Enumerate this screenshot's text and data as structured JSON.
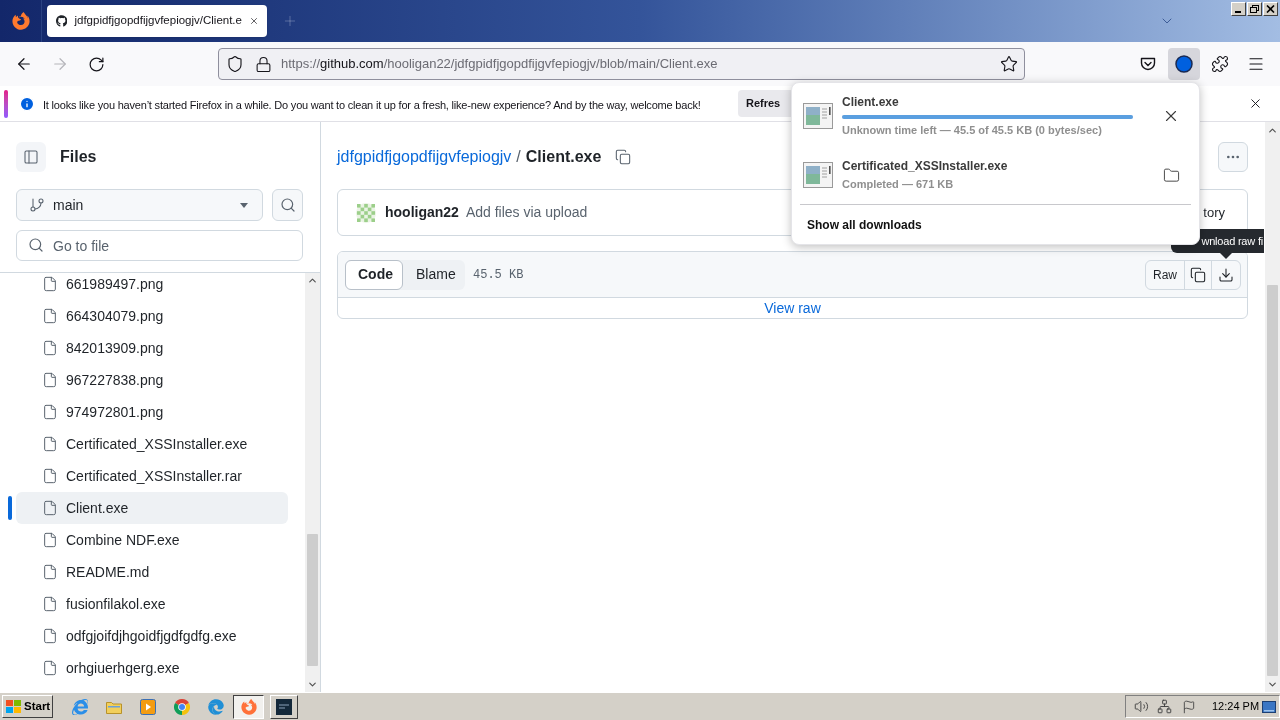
{
  "browser": {
    "tabs": [
      {
        "title": "jdfgpidfjgopdfijgvfepiogjv/Client.e",
        "selected": true
      }
    ],
    "nav": {
      "back_disabled": false,
      "forward_disabled": true
    },
    "address": {
      "scheme": "https://",
      "host": "github.com",
      "path": "/hooligan22/jdfgpidfjgopdfijgvfepiogjv/blob/main/Client.exe"
    },
    "downloads_button": {
      "open": true
    }
  },
  "notification": {
    "message": "It looks like you haven’t started Firefox in a while. Do you want to clean it up for a fresh, like-new experience? And by the way, welcome back!",
    "button": "Refres"
  },
  "downloads_panel": {
    "items": [
      {
        "kind": "in_progress",
        "name": "Client.exe",
        "level": 1,
        "status": "Unknown time left — 45.5 of 45.5 KB (0 bytes/sec)"
      },
      {
        "kind": "completed",
        "name": "Certificated_XSSInstaller.exe",
        "status": "Completed — 671 KB"
      }
    ],
    "footer": "Show all downloads"
  },
  "sidebar": {
    "title": "Files",
    "branch": "main",
    "search": {
      "placeholder": "Go to file"
    },
    "files": [
      {
        "name": "661989497.png",
        "selected": false
      },
      {
        "name": "664304079.png",
        "selected": false
      },
      {
        "name": "842013909.png",
        "selected": false
      },
      {
        "name": "967227838.png",
        "selected": false
      },
      {
        "name": "974972801.png",
        "selected": false
      },
      {
        "name": "Certificated_XSSInstaller.exe",
        "selected": false
      },
      {
        "name": "Certificated_XSSInstaller.rar",
        "selected": false
      },
      {
        "name": "Client.exe",
        "selected": true
      },
      {
        "name": "Combine NDF.exe",
        "selected": false
      },
      {
        "name": "README.md",
        "selected": false
      },
      {
        "name": "fusionfilakol.exe",
        "selected": false
      },
      {
        "name": "odfgjoifdjhgoidfjgdfgdfg.exe",
        "selected": false
      },
      {
        "name": "orhgiuerhgerg.exe",
        "selected": false
      }
    ]
  },
  "file_header": {
    "repo": "jdfgpidfjgopdfijgvfepiogjv",
    "separator": "/",
    "file": "Client.exe"
  },
  "commit": {
    "author": "hooligan22",
    "message": "Add files via upload",
    "history": "tory"
  },
  "file_view": {
    "tabs": [
      {
        "label": "Code",
        "selected": true
      },
      {
        "label": "Blame",
        "selected": false
      }
    ],
    "size": "45.5 KB",
    "raw_button": "Raw",
    "view_raw": "View raw",
    "tooltip": "wnload raw fi"
  },
  "taskbar": {
    "start": "Start",
    "quick_launch": [
      {
        "kind": "ie"
      },
      {
        "kind": "explorer"
      },
      {
        "kind": "media"
      },
      {
        "kind": "chrome"
      },
      {
        "kind": "edge"
      }
    ],
    "tasks": [
      {
        "kind": "firefox",
        "selected": true
      },
      {
        "kind": "terminal",
        "selected": false
      }
    ],
    "clock": "12:24 PM"
  }
}
